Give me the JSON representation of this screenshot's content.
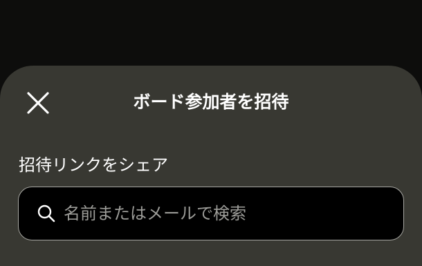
{
  "sheet": {
    "title": "ボード参加者を招待",
    "close_icon": "close-icon"
  },
  "share": {
    "label": "招待リンクをシェア"
  },
  "search": {
    "icon": "search-icon",
    "placeholder": "名前またはメールで検索",
    "value": ""
  },
  "colors": {
    "backdrop": "#0d0d0c",
    "sheet_background": "#383832",
    "search_background": "#000000",
    "search_border": "#a7a7a2",
    "placeholder_text": "#9c9c98",
    "primary_text": "#ffffff"
  }
}
